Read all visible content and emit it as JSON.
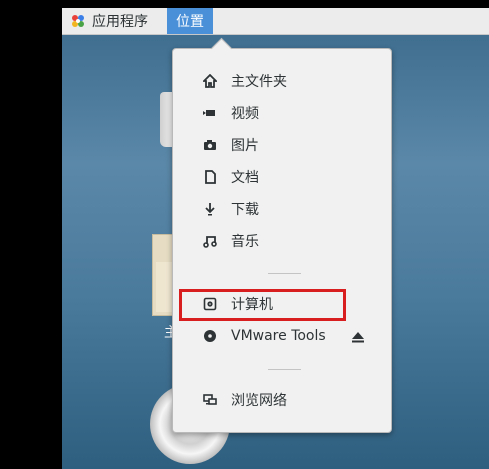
{
  "topbar": {
    "apps_label": "应用程序",
    "places_label": "位置"
  },
  "desktop": {
    "home_label": "主"
  },
  "menu": {
    "items": [
      {
        "label": "主文件夹",
        "icon": "home-icon"
      },
      {
        "label": "视频",
        "icon": "video-icon"
      },
      {
        "label": "图片",
        "icon": "camera-icon"
      },
      {
        "label": "文档",
        "icon": "document-icon"
      },
      {
        "label": "下载",
        "icon": "download-icon"
      },
      {
        "label": "音乐",
        "icon": "music-icon"
      },
      {
        "label": "计算机",
        "icon": "drive-icon"
      },
      {
        "label": "VMware Tools",
        "icon": "disc-icon"
      },
      {
        "label": "浏览网络",
        "icon": "network-icon"
      }
    ],
    "highlight_color": "#d81e1e"
  }
}
